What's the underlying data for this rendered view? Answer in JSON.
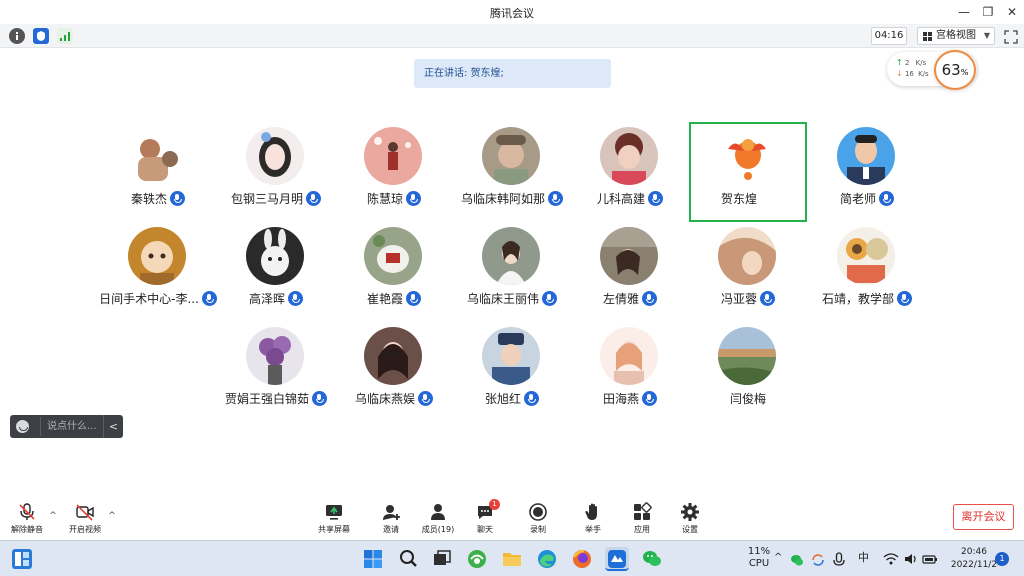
{
  "window": {
    "title": "腾讯会议"
  },
  "toolbar": {
    "timer": "04:16",
    "view_mode": "宫格视图"
  },
  "speaking_banner": {
    "text": "正在讲话: 贺东煌;"
  },
  "network": {
    "upload": "2",
    "upload_unit": "K/s",
    "download": "16",
    "download_unit": "K/s",
    "cpu_value": "63",
    "cpu_unit": "%"
  },
  "participants": [
    {
      "name": "秦轶杰",
      "color": "#e9d7c8"
    },
    {
      "name": "包钢三马月明",
      "color": "#d9c8c8"
    },
    {
      "name": "陈慧琼",
      "color": "#e8a8a0"
    },
    {
      "name": "乌临床韩阿如那",
      "color": "#a79a86"
    },
    {
      "name": "儿科高建",
      "color": "#c9a49a"
    },
    {
      "name": "贺东煌",
      "color": "#ffffff"
    },
    {
      "name": "简老师",
      "color": "#4aa3e8"
    },
    {
      "name": "日间手术中心-李...",
      "color": "#c4862c"
    },
    {
      "name": "高泽晖",
      "color": "#2a2a2a"
    },
    {
      "name": "崔艳霞",
      "color": "#97a48a"
    },
    {
      "name": "乌临床王丽伟",
      "color": "#8f9a8c"
    },
    {
      "name": "左倩雅",
      "color": "#8a8070"
    },
    {
      "name": "冯亚蓉",
      "color": "#e8c8b0"
    },
    {
      "name": "石靖，教学部",
      "color": "#e0c89a"
    },
    {
      "name": "贾娟王强白锦茹",
      "color": "#7a5c8a"
    },
    {
      "name": "乌临床燕娱",
      "color": "#6a5048"
    },
    {
      "name": "张旭红",
      "color": "#4a6c8a"
    },
    {
      "name": "田海燕",
      "color": "#f2d8d0"
    },
    {
      "name": "闫俊梅",
      "color": "#6f8a5a"
    }
  ],
  "chat": {
    "placeholder": "说点什么..."
  },
  "controls": {
    "unmute": "解除静音",
    "start_video": "开启视频",
    "share_screen": "共享屏幕",
    "invite": "邀请",
    "members": "成员(19)",
    "chat": "聊天",
    "chat_badge": "1",
    "record": "录制",
    "raise_hand": "举手",
    "apps": "应用",
    "settings": "设置",
    "leave": "离开会议"
  },
  "taskbar": {
    "cpu_value": "11%",
    "cpu_label": "CPU",
    "ime": "中",
    "time": "20:46",
    "date": "2022/11/2",
    "notifications": "1"
  },
  "colors": {
    "accent_blue": "#2468d8",
    "active_border": "#22b14c",
    "leave_red": "#e0302c"
  }
}
